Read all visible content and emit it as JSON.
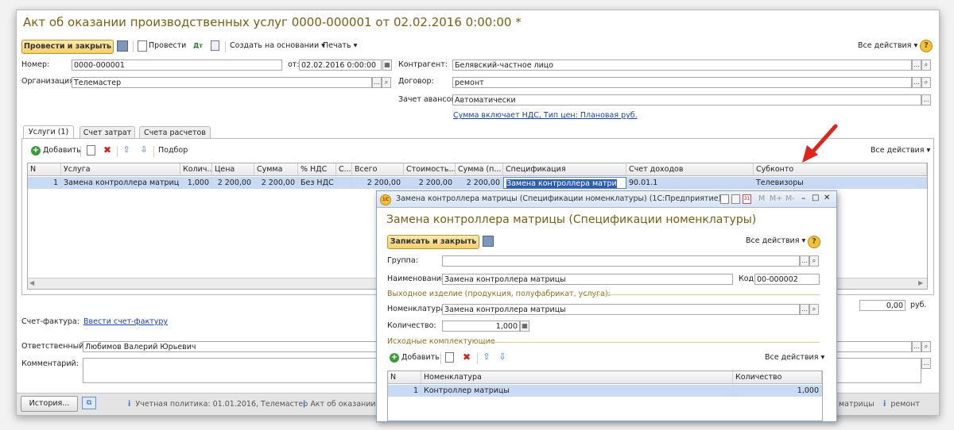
{
  "main": {
    "title": "Акт об оказании производственных услуг 0000-000001 от 02.02.2016 0:00:00 *",
    "toolbar": {
      "post_close": "Провести и закрыть",
      "post": "Провести",
      "create_based": "Создать на основании",
      "print": "Печать",
      "all_actions": "Все действия"
    },
    "fields": {
      "number_label": "Номер:",
      "number_value": "0000-000001",
      "date_label": "от:",
      "date_value": "02.02.2016  0:00:00",
      "org_label": "Организация:",
      "org_value": "Телемастер",
      "counterparty_label": "Контрагент:",
      "counterparty_value": "Белявский-частное лицо",
      "contract_label": "Договор:",
      "contract_value": "ремонт",
      "advance_label": "Зачет авансов:",
      "advance_value": "Автоматически",
      "vat_link": "Сумма включает НДС, Тип цен: Плановая руб."
    },
    "tabs": [
      "Услуги (1)",
      "Счет затрат",
      "Счета расчетов"
    ],
    "grid_toolbar": {
      "add": "Добавить",
      "selection": "Подбор",
      "all_actions": "Все действия"
    },
    "grid": {
      "headers": [
        "N",
        "Услуга",
        "Колич...",
        "Цена",
        "Сумма",
        "% НДС",
        "С...",
        "Всего",
        "Стоимость...",
        "Сумма (п...",
        "Спецификация",
        "Счет доходов",
        "Субконто"
      ],
      "rows": [
        [
          "1",
          "Замена контроллера матрицы",
          "1,000",
          "2 200,00",
          "2 200,00",
          "Без НДС",
          "",
          "2 200,00",
          "2 200,00",
          "2 200,00",
          "Замена контроллера матри",
          "90.01.1",
          "Телевизоры"
        ]
      ]
    },
    "total_value": "0,00",
    "total_unit": "руб.",
    "invoice_label": "Счет-фактура:",
    "invoice_link": "Ввести счет-фактуру",
    "responsible_label": "Ответственный:",
    "responsible_value": "Любимов Валерий Юрьевич",
    "comment_label": "Комментарий:"
  },
  "statusbar": {
    "history": "История...",
    "policy": "Учетная политика: 01.01.2016, Телемастер",
    "act": "Акт об оказании",
    "tail1": "матрицы",
    "tail2": "ремонт"
  },
  "dialog": {
    "window_title": "Замена контроллера матрицы (Спецификации номенклатуры)  (1С:Предприятие)",
    "window_controls": [
      "M",
      "M+",
      "M-"
    ],
    "heading": "Замена контроллера матрицы (Спецификации номенклатуры)",
    "save_close": "Записать и закрыть",
    "all_actions": "Все действия",
    "group_label": "Группа:",
    "group_value": "",
    "name_label": "Наименование:",
    "name_value": "Замена контроллера матрицы",
    "code_label": "Код:",
    "code_value": "00-000002",
    "output_section": "Выходное изделие (продукция, полуфабрикат, услуга):",
    "nomenclature_label": "Номенклатура:",
    "nomenclature_value": "Замена контроллера матрицы",
    "quantity_label": "Количество:",
    "quantity_value": "1,000",
    "source_section": "Исходные комплектующие",
    "add": "Добавить",
    "grid_all_actions": "Все действия",
    "grid_headers": [
      "N",
      "Номенклатура",
      "Количество"
    ],
    "grid_rows": [
      [
        "1",
        "Контроллер матрицы",
        "1,000"
      ]
    ]
  },
  "colors": {
    "title": "#7a5f12",
    "link": "#1a3fa8",
    "selected_row": "#c8daf4",
    "arrow": "#e0231b"
  }
}
